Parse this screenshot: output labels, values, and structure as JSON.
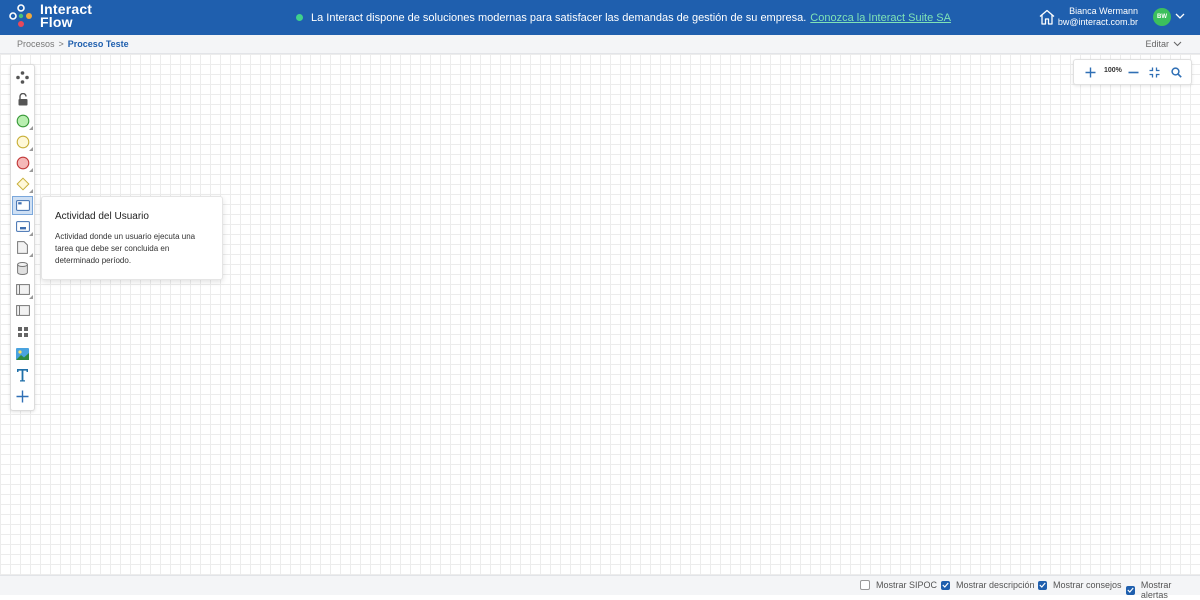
{
  "header": {
    "logo_line1": "Interact",
    "logo_line2": "Flow",
    "banner_text": "La Interact dispone de soluciones modernas para satisfacer las demandas de gestión de su empresa.",
    "banner_link": "Conozca la Interact Suite SA",
    "user_name": "Bianca Wermann",
    "user_email": "bw@interact.com.br",
    "avatar_initials": "BW"
  },
  "breadcrumb": {
    "parent": "Procesos",
    "separator": ">",
    "current": "Proceso Teste",
    "edit_label": "Editar"
  },
  "toolbar": {
    "tools": [
      {
        "name": "move-tool-icon"
      },
      {
        "name": "lock-tool-icon"
      },
      {
        "name": "start-event-icon"
      },
      {
        "name": "intermediate-event-icon"
      },
      {
        "name": "end-event-icon"
      },
      {
        "name": "gateway-icon"
      },
      {
        "name": "user-activity-icon"
      },
      {
        "name": "system-activity-icon"
      },
      {
        "name": "document-icon"
      },
      {
        "name": "database-icon"
      },
      {
        "name": "pool-icon"
      },
      {
        "name": "lane-icon"
      },
      {
        "name": "group-icon"
      },
      {
        "name": "image-icon"
      },
      {
        "name": "text-icon"
      },
      {
        "name": "add-icon"
      }
    ]
  },
  "tooltip": {
    "title": "Actividad del Usuario",
    "description": "Actividad donde un usuario ejecuta una tarea que debe ser concluida en determinado período."
  },
  "zoom": {
    "level": "100%"
  },
  "footer": {
    "options": [
      {
        "label": "Mostrar SIPOC",
        "checked": false
      },
      {
        "label": "Mostrar descripción",
        "checked": true
      },
      {
        "label": "Mostrar consejos",
        "checked": true
      },
      {
        "label": "Mostrar alertas",
        "checked": true
      }
    ]
  },
  "colors": {
    "header_bg": "#1f5fae",
    "accent": "#1f5fae",
    "banner_dot": "#3fd18b",
    "avatar_bg": "#3cbf5d"
  }
}
